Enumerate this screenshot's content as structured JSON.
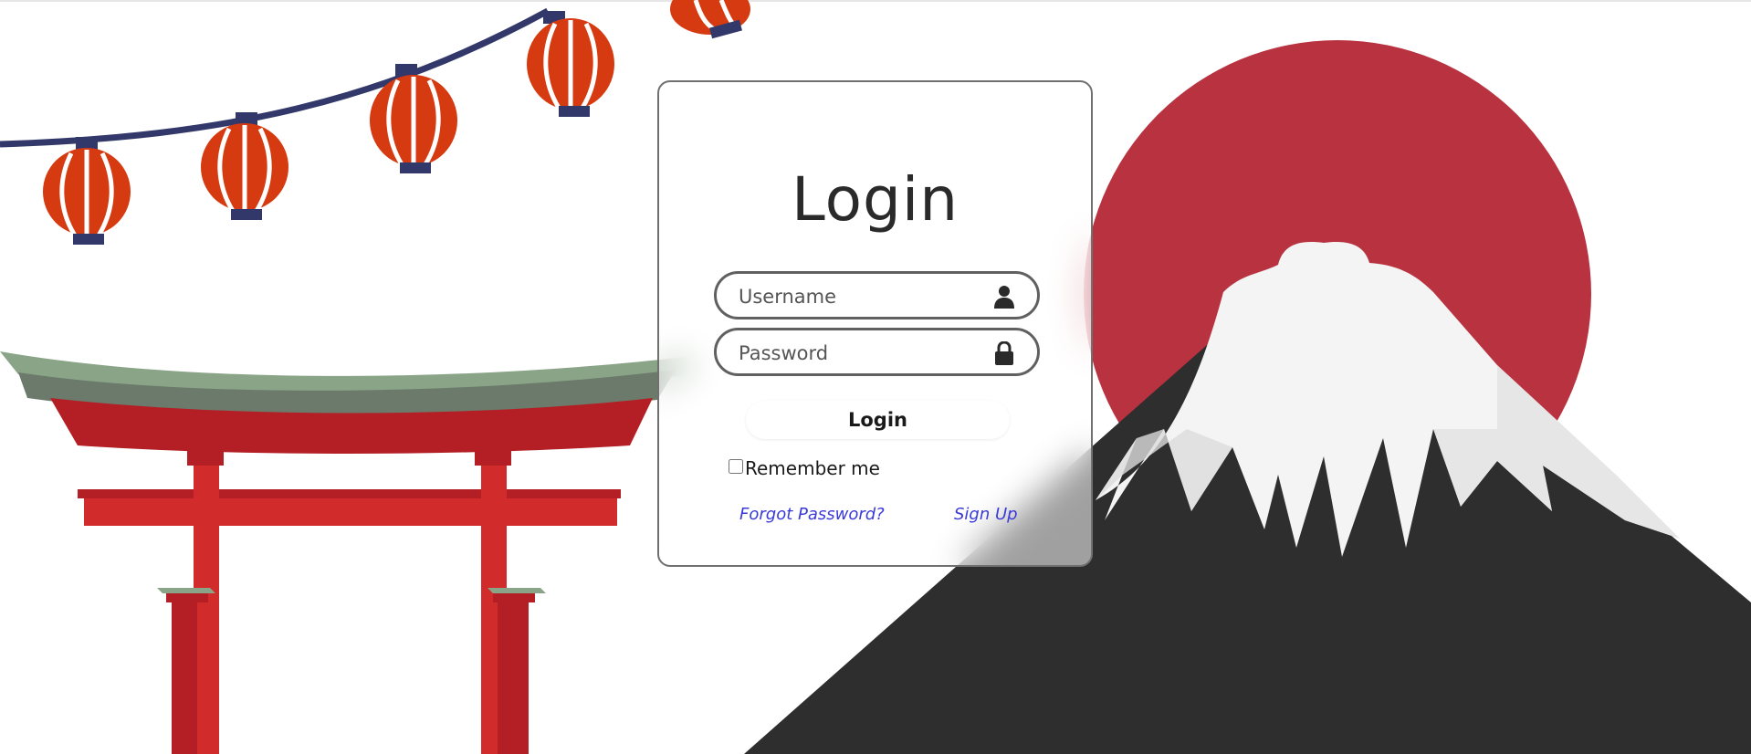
{
  "login": {
    "title": "Login",
    "username_placeholder": "Username",
    "password_placeholder": "Password",
    "submit_label": "Login",
    "remember_label": "Remember me",
    "remember_checked": false,
    "forgot_password_label": "Forgot Password?",
    "sign_up_label": "Sign Up"
  },
  "icons": {
    "username": "user-icon",
    "password": "lock-icon"
  },
  "colors": {
    "card_border": "#707070",
    "link": "#3a3ad8",
    "sun": "#b83240",
    "mountain": "#2e2e2e",
    "snow": "#f4f4f4",
    "torii": "#d22b2b",
    "torii_roof": "#8aa488",
    "lantern": "#d63a10",
    "lantern_cap": "#33386a"
  }
}
